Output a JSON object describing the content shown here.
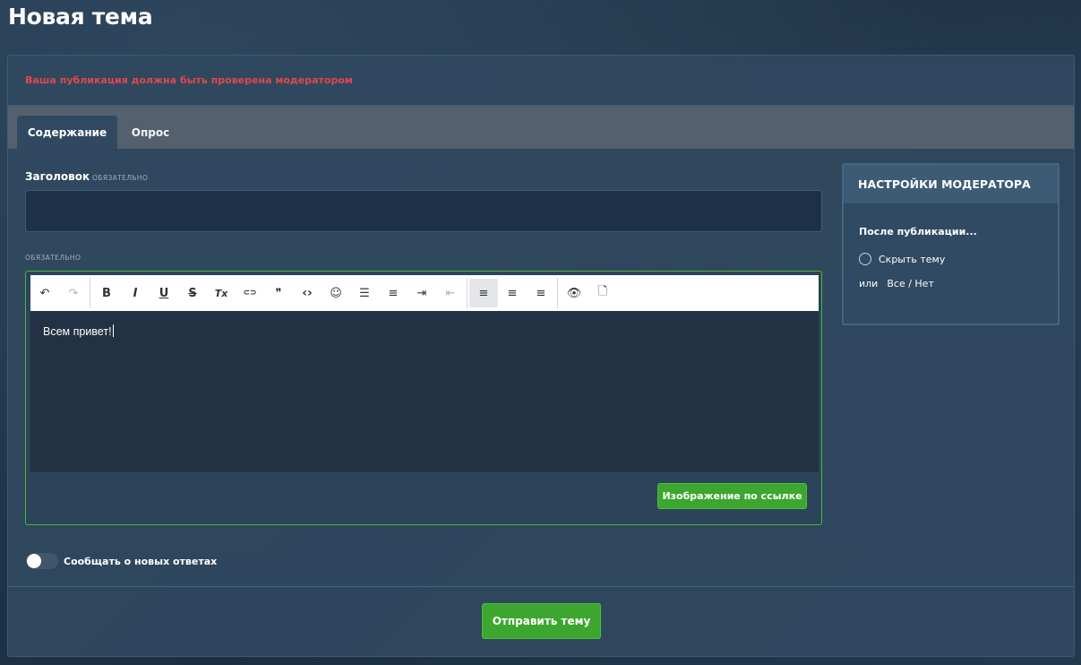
{
  "page": {
    "title": "Новая тема"
  },
  "notice": {
    "text": "Ваша публикация должна быть проверена модератором",
    "color": "#e0474c"
  },
  "tabs": [
    {
      "label": "Содержание",
      "active": true
    },
    {
      "label": "Опрос",
      "active": false
    }
  ],
  "title_field": {
    "label": "Заголовок",
    "required_tag": "ОБЯЗАТЕЛЬНО",
    "value": "",
    "placeholder": ""
  },
  "editor": {
    "required_tag": "ОБЯЗАТЕЛЬНО",
    "content": "Всем привет!",
    "toolbar": [
      {
        "name": "undo-icon",
        "glyph": "↶",
        "disabled": false
      },
      {
        "name": "redo-icon",
        "glyph": "↷",
        "disabled": true
      },
      {
        "name": "sep"
      },
      {
        "name": "bold-icon",
        "glyph": "B",
        "disabled": false
      },
      {
        "name": "italic-icon",
        "glyph": "I",
        "disabled": false
      },
      {
        "name": "underline-icon",
        "glyph": "U",
        "disabled": false
      },
      {
        "name": "strikethrough-icon",
        "glyph": "S",
        "disabled": false
      },
      {
        "name": "clear-format-icon",
        "glyph": "Tx",
        "disabled": false
      },
      {
        "name": "link-icon",
        "glyph": "⊂⊃",
        "disabled": false
      },
      {
        "name": "quote-icon",
        "glyph": "❞",
        "disabled": false
      },
      {
        "name": "code-icon",
        "glyph": "‹›",
        "disabled": false
      },
      {
        "name": "emoji-icon",
        "glyph": "☺",
        "disabled": false
      },
      {
        "name": "bullet-list-icon",
        "glyph": "☰",
        "disabled": false
      },
      {
        "name": "numbered-list-icon",
        "glyph": "≡",
        "disabled": false
      },
      {
        "name": "indent-icon",
        "glyph": "⇥",
        "disabled": false
      },
      {
        "name": "outdent-icon",
        "glyph": "⇤",
        "disabled": true
      },
      {
        "name": "sep"
      },
      {
        "name": "align-left-icon",
        "glyph": "≡",
        "disabled": false,
        "selected": true
      },
      {
        "name": "align-center-icon",
        "glyph": "≡",
        "disabled": false
      },
      {
        "name": "align-right-icon",
        "glyph": "≡",
        "disabled": false
      },
      {
        "name": "sep"
      },
      {
        "name": "preview-icon",
        "glyph": "👁",
        "disabled": false
      },
      {
        "name": "full-preview-icon",
        "glyph": "🗋",
        "disabled": false
      }
    ],
    "image_link_label": "Изображение по ссылке"
  },
  "notify": {
    "label": "Сообщать о новых ответах",
    "enabled": false
  },
  "submit": {
    "label": "Отправить тему"
  },
  "moderator": {
    "header": "НАСТРОЙКИ МОДЕРАТОРА",
    "after_publish": "После публикации...",
    "hide_topic_label": "Скрыть тему",
    "or_label": "или",
    "all_none_label": "Все / Нет"
  },
  "colors": {
    "accent_green": "#3ca62f",
    "editor_border": "#47b83c"
  }
}
